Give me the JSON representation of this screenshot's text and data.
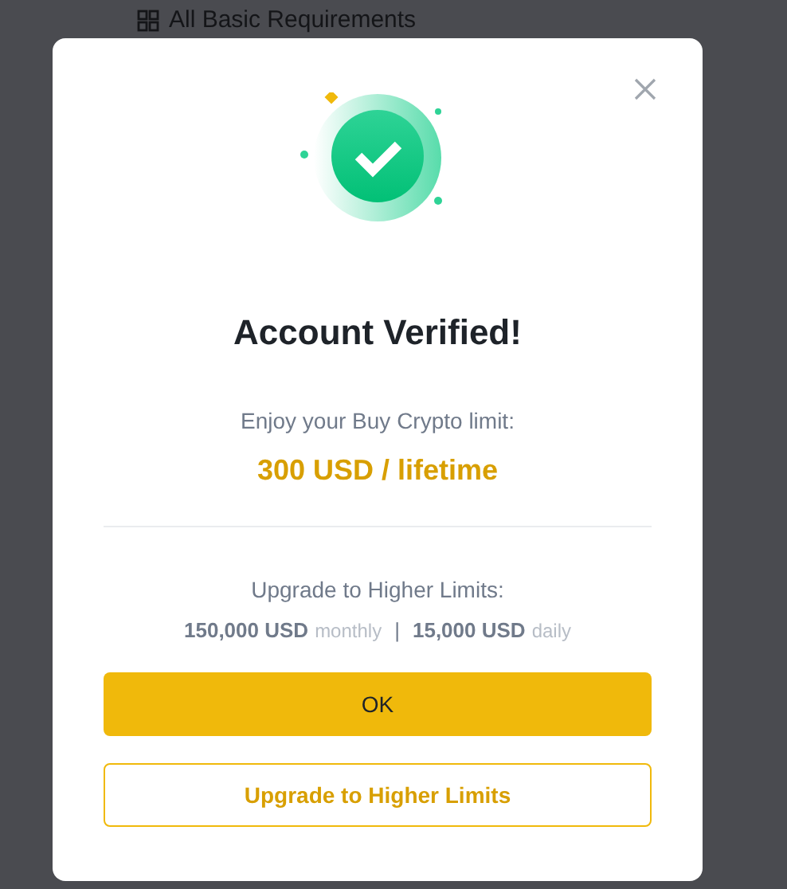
{
  "background": {
    "heading": "All Basic Requirements"
  },
  "dialog": {
    "title": "Account Verified!",
    "subtitle": "Enjoy your Buy Crypto limit:",
    "limit": "300 USD / lifetime",
    "upgrade_label": "Upgrade to Higher Limits:",
    "limits": [
      {
        "amount": "150,000 USD",
        "period": "monthly"
      },
      {
        "amount": "15,000 USD",
        "period": "daily"
      }
    ],
    "separator": "|",
    "buttons": [
      {
        "label": "OK",
        "kind": "primary"
      },
      {
        "label": "Upgrade to Higher Limits",
        "kind": "outline"
      }
    ]
  }
}
